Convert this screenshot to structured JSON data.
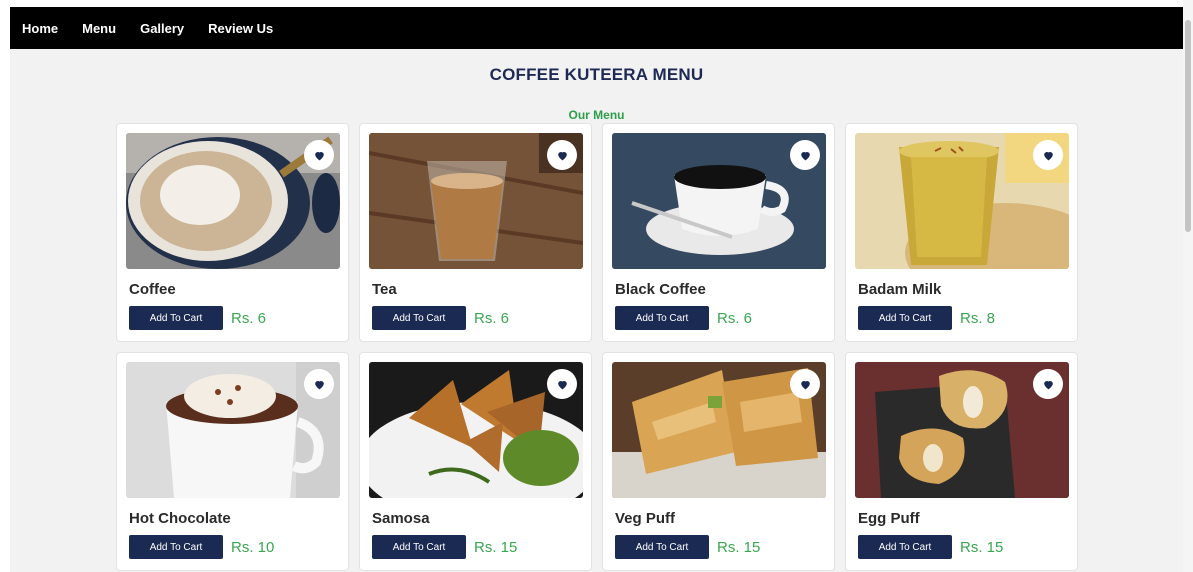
{
  "nav": {
    "links": [
      "Home",
      "Menu",
      "Gallery",
      "Review Us"
    ]
  },
  "header": {
    "title": "COFFEE KUTEERA MENU",
    "subtitle": "Our Menu"
  },
  "menu": {
    "cart_label": "Add To Cart",
    "items": [
      {
        "name": "Coffee",
        "price": "Rs. 6"
      },
      {
        "name": "Tea",
        "price": "Rs. 6"
      },
      {
        "name": "Black Coffee",
        "price": "Rs. 6"
      },
      {
        "name": "Badam Milk",
        "price": "Rs. 8"
      },
      {
        "name": "Hot Chocolate",
        "price": "Rs. 10"
      },
      {
        "name": "Samosa",
        "price": "Rs. 15"
      },
      {
        "name": "Veg Puff",
        "price": "Rs. 15"
      },
      {
        "name": "Egg Puff",
        "price": "Rs. 15"
      }
    ]
  },
  "colors": {
    "navbar": "#000000",
    "title": "#1e2a55",
    "subtitle": "#2e9e4a",
    "button": "#1b2a52",
    "price": "#3aa652"
  }
}
